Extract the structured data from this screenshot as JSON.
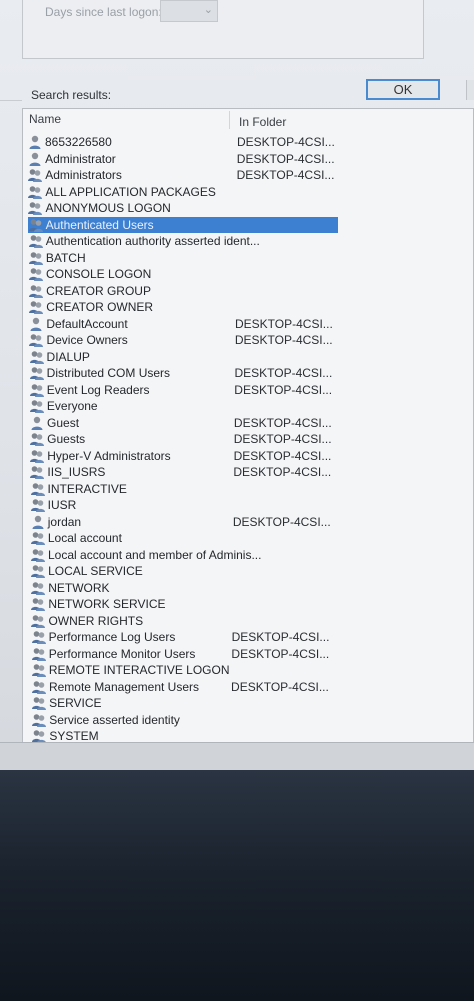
{
  "filters": {
    "days_label": "Days since last logon:"
  },
  "dialog": {
    "ok_label": "OK",
    "search_results_label": "Search results:"
  },
  "columns": {
    "name": "Name",
    "folder": "In Folder"
  },
  "results": [
    {
      "name": "8653226580",
      "folder": "DESKTOP-4CSI...",
      "icon": "user-icon"
    },
    {
      "name": "Administrator",
      "folder": "DESKTOP-4CSI...",
      "icon": "user-icon"
    },
    {
      "name": "Administrators",
      "folder": "DESKTOP-4CSI...",
      "icon": "group-icon"
    },
    {
      "name": "ALL APPLICATION PACKAGES",
      "folder": "",
      "icon": "group-icon"
    },
    {
      "name": "ANONYMOUS LOGON",
      "folder": "",
      "icon": "group-icon"
    },
    {
      "name": "Authenticated Users",
      "folder": "",
      "icon": "group-icon",
      "selected": true
    },
    {
      "name": "Authentication authority asserted ident...",
      "folder": "",
      "icon": "group-icon"
    },
    {
      "name": "BATCH",
      "folder": "",
      "icon": "group-icon"
    },
    {
      "name": "CONSOLE LOGON",
      "folder": "",
      "icon": "group-icon"
    },
    {
      "name": "CREATOR GROUP",
      "folder": "",
      "icon": "group-icon"
    },
    {
      "name": "CREATOR OWNER",
      "folder": "",
      "icon": "group-icon"
    },
    {
      "name": "DefaultAccount",
      "folder": "DESKTOP-4CSI...",
      "icon": "user-icon"
    },
    {
      "name": "Device Owners",
      "folder": "DESKTOP-4CSI...",
      "icon": "group-icon"
    },
    {
      "name": "DIALUP",
      "folder": "",
      "icon": "group-icon"
    },
    {
      "name": "Distributed COM Users",
      "folder": "DESKTOP-4CSI...",
      "icon": "group-icon"
    },
    {
      "name": "Event Log Readers",
      "folder": "DESKTOP-4CSI...",
      "icon": "group-icon"
    },
    {
      "name": "Everyone",
      "folder": "",
      "icon": "group-icon"
    },
    {
      "name": "Guest",
      "folder": "DESKTOP-4CSI...",
      "icon": "user-icon"
    },
    {
      "name": "Guests",
      "folder": "DESKTOP-4CSI...",
      "icon": "group-icon"
    },
    {
      "name": "Hyper-V Administrators",
      "folder": "DESKTOP-4CSI...",
      "icon": "group-icon"
    },
    {
      "name": "IIS_IUSRS",
      "folder": "DESKTOP-4CSI...",
      "icon": "group-icon"
    },
    {
      "name": "INTERACTIVE",
      "folder": "",
      "icon": "group-icon"
    },
    {
      "name": "IUSR",
      "folder": "",
      "icon": "group-icon"
    },
    {
      "name": "jordan",
      "folder": "DESKTOP-4CSI...",
      "icon": "user-icon"
    },
    {
      "name": "Local account",
      "folder": "",
      "icon": "group-icon"
    },
    {
      "name": "Local account and member of Adminis...",
      "folder": "",
      "icon": "group-icon"
    },
    {
      "name": "LOCAL SERVICE",
      "folder": "",
      "icon": "group-icon"
    },
    {
      "name": "NETWORK",
      "folder": "",
      "icon": "group-icon"
    },
    {
      "name": "NETWORK SERVICE",
      "folder": "",
      "icon": "group-icon"
    },
    {
      "name": "OWNER RIGHTS",
      "folder": "",
      "icon": "group-icon"
    },
    {
      "name": "Performance Log Users",
      "folder": "DESKTOP-4CSI...",
      "icon": "group-icon"
    },
    {
      "name": "Performance Monitor Users",
      "folder": "DESKTOP-4CSI...",
      "icon": "group-icon"
    },
    {
      "name": "REMOTE INTERACTIVE LOGON",
      "folder": "",
      "icon": "group-icon"
    },
    {
      "name": "Remote Management Users",
      "folder": "DESKTOP-4CSI...",
      "icon": "group-icon"
    },
    {
      "name": "SERVICE",
      "folder": "",
      "icon": "group-icon"
    },
    {
      "name": "Service asserted identity",
      "folder": "",
      "icon": "group-icon"
    },
    {
      "name": "SYSTEM",
      "folder": "",
      "icon": "group-icon"
    }
  ],
  "colors": {
    "selection": "#3d7fd1",
    "ok_border": "#4a8ad0"
  }
}
